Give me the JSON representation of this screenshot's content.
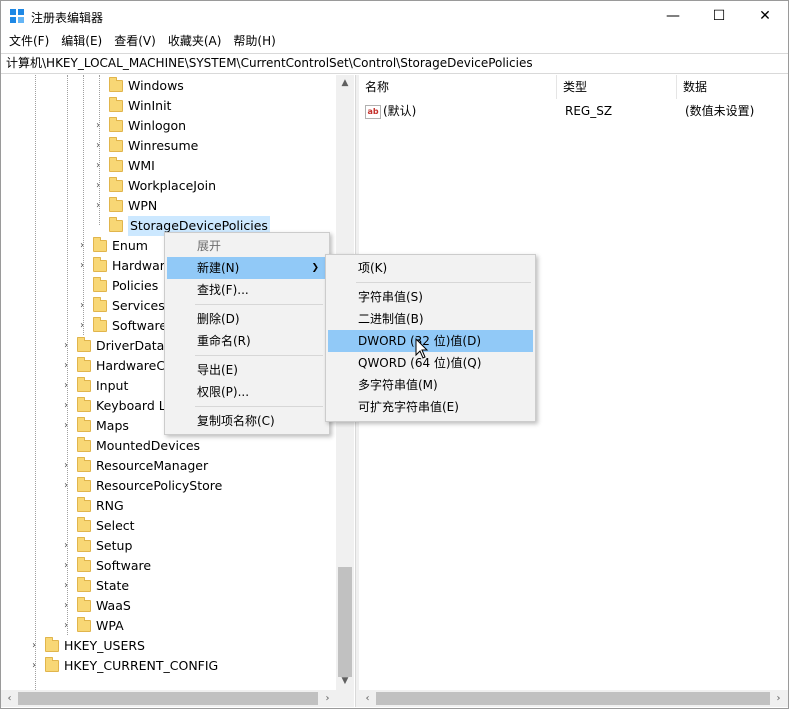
{
  "window": {
    "title": "注册表编辑器",
    "min_glyph": "—",
    "max_glyph": "☐",
    "close_glyph": "✕"
  },
  "menubar": [
    "文件(F)",
    "编辑(E)",
    "查看(V)",
    "收藏夹(A)",
    "帮助(H)"
  ],
  "address": "计算机\\HKEY_LOCAL_MACHINE\\SYSTEM\\CurrentControlSet\\Control\\StorageDevicePolicies",
  "tree": [
    {
      "label": "Windows",
      "depth": 3,
      "expander": false
    },
    {
      "label": "WinInit",
      "depth": 3,
      "expander": false
    },
    {
      "label": "Winlogon",
      "depth": 3,
      "expander": true
    },
    {
      "label": "Winresume",
      "depth": 3,
      "expander": true
    },
    {
      "label": "WMI",
      "depth": 3,
      "expander": true
    },
    {
      "label": "WorkplaceJoin",
      "depth": 3,
      "expander": true
    },
    {
      "label": "WPN",
      "depth": 3,
      "expander": true
    },
    {
      "label": "StorageDevicePolicies",
      "depth": 3,
      "expander": false,
      "selected": true
    },
    {
      "label": "Enum",
      "depth": 2,
      "expander": true
    },
    {
      "label": "Hardware",
      "depth": 2,
      "expander": true
    },
    {
      "label": "Policies",
      "depth": 2,
      "expander": false
    },
    {
      "label": "Services",
      "depth": 2,
      "expander": true
    },
    {
      "label": "Software",
      "depth": 2,
      "expander": true
    },
    {
      "label": "DriverDataba",
      "depth": 1,
      "expander": true
    },
    {
      "label": "HardwareCo",
      "depth": 1,
      "expander": true
    },
    {
      "label": "Input",
      "depth": 1,
      "expander": true
    },
    {
      "label": "Keyboard La",
      "depth": 1,
      "expander": true
    },
    {
      "label": "Maps",
      "depth": 1,
      "expander": true
    },
    {
      "label": "MountedDevices",
      "depth": 1,
      "expander": false
    },
    {
      "label": "ResourceManager",
      "depth": 1,
      "expander": true
    },
    {
      "label": "ResourcePolicyStore",
      "depth": 1,
      "expander": true
    },
    {
      "label": "RNG",
      "depth": 1,
      "expander": false
    },
    {
      "label": "Select",
      "depth": 1,
      "expander": false
    },
    {
      "label": "Setup",
      "depth": 1,
      "expander": true
    },
    {
      "label": "Software",
      "depth": 1,
      "expander": true
    },
    {
      "label": "State",
      "depth": 1,
      "expander": true
    },
    {
      "label": "WaaS",
      "depth": 1,
      "expander": true
    },
    {
      "label": "WPA",
      "depth": 1,
      "expander": true
    },
    {
      "label": "HKEY_USERS",
      "depth": 0,
      "expander": true
    },
    {
      "label": "HKEY_CURRENT_CONFIG",
      "depth": 0,
      "expander": true
    }
  ],
  "columns": {
    "name": "名称",
    "type": "类型",
    "data": "数据"
  },
  "values": [
    {
      "icon": "ab",
      "name": "(默认)",
      "type": "REG_SZ",
      "data": "(数值未设置)"
    }
  ],
  "context_menu": {
    "items": [
      {
        "label": "展开",
        "disabled": true
      },
      {
        "label": "新建(N)",
        "highlighted": true,
        "submenu": true
      },
      {
        "label": "查找(F)..."
      },
      {
        "label": "删除(D)"
      },
      {
        "label": "重命名(R)"
      },
      {
        "label": "导出(E)"
      },
      {
        "label": "权限(P)..."
      },
      {
        "label": "复制项名称(C)"
      }
    ]
  },
  "new_submenu": {
    "items": [
      {
        "label": "项(K)"
      },
      {
        "label": "字符串值(S)"
      },
      {
        "label": "二进制值(B)"
      },
      {
        "label": "DWORD (32 位)值(D)",
        "highlighted": true
      },
      {
        "label": "QWORD (64 位)值(Q)"
      },
      {
        "label": "多字符串值(M)"
      },
      {
        "label": "可扩充字符串值(E)"
      }
    ]
  },
  "colors": {
    "selection": "#cce8ff",
    "menu_highlight": "#91c9f7",
    "folder": "#f8d775"
  }
}
